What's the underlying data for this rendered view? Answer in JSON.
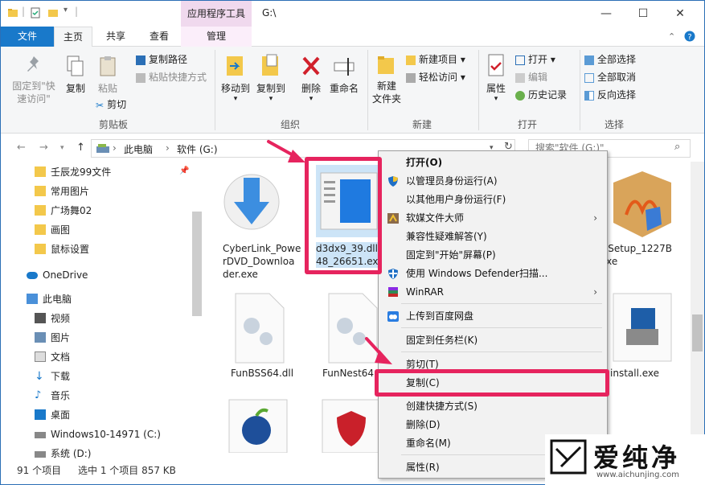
{
  "window": {
    "context_tab_title": "应用程序工具",
    "title": "G:\\",
    "controls": {
      "minimize": "—",
      "maximize": "☐",
      "close": "✕"
    }
  },
  "ribbon_tabs": {
    "file": "文件",
    "home": "主页",
    "share": "共享",
    "view": "查看",
    "manage": "管理"
  },
  "ribbon": {
    "clipboard": {
      "pin": "固定到\"快\n速访问\"",
      "pin_l1": "固定到\"快",
      "pin_l2": "速访问\"",
      "copy": "复制",
      "paste": "粘贴",
      "copy_path": "复制路径",
      "paste_shortcut": "粘贴快捷方式",
      "cut": "剪切",
      "group": "剪贴板"
    },
    "organize": {
      "move_to": "移动到",
      "copy_to": "复制到",
      "delete": "删除",
      "rename": "重命名",
      "group": "组织"
    },
    "new": {
      "new_folder_l1": "新建",
      "new_folder_l2": "文件夹",
      "new_item": "新建项目",
      "easy_access": "轻松访问",
      "group": "新建"
    },
    "open": {
      "properties": "属性",
      "open": "打开",
      "edit": "编辑",
      "history": "历史记录",
      "group": "打开"
    },
    "select": {
      "select_all": "全部选择",
      "select_none": "全部取消",
      "invert": "反向选择",
      "group": "选择"
    }
  },
  "address": {
    "crumbs": [
      "此电脑",
      "软件 (G:)"
    ],
    "separator": "›",
    "search_placeholder": "搜索\"软件 (G:)\""
  },
  "nav": {
    "quick": [
      "壬辰龙99文件",
      "常用图片",
      "广场舞02",
      "画图",
      "鼠标设置"
    ],
    "onedrive": "OneDrive",
    "this_pc": "此电脑",
    "pc_items": [
      "视频",
      "图片",
      "文档",
      "下载",
      "音乐",
      "桌面",
      "Windows10-14971 (C:)",
      "系统 (D:)"
    ]
  },
  "files": [
    {
      "name_l1": "CyberLink_Powe",
      "name_l2": "rDVD_Downloa",
      "name_l3": "der.exe"
    },
    {
      "name_l1": "d3dx9_39.dll-",
      "name_l2": "48_26651.exe",
      "name_l3": ""
    },
    {
      "name_l1": "GSetup_1227B",
      "name_l2": "exe",
      "name_l3": ""
    },
    {
      "name_l1": "FunBSS64.dll",
      "name_l2": "",
      "name_l3": ""
    },
    {
      "name_l1": "FunNest64.",
      "name_l2": "",
      "name_l3": ""
    },
    {
      "name_l1": "install.exe",
      "name_l2": "",
      "name_l3": ""
    }
  ],
  "status": {
    "count": "91 个项目",
    "selected": "选中 1 个项目  857 KB"
  },
  "context_menu": [
    {
      "label": "打开(O)",
      "bold": true
    },
    {
      "label": "以管理员身份运行(A)",
      "icon": "shield-icon"
    },
    {
      "label": "以其他用户身份运行(F)"
    },
    {
      "label": "软媒文件大师",
      "icon": "app-icon",
      "submenu": true
    },
    {
      "label": "兼容性疑难解答(Y)"
    },
    {
      "label": "固定到\"开始\"屏幕(P)"
    },
    {
      "label": "使用 Windows Defender扫描...",
      "icon": "defender-icon"
    },
    {
      "label": "WinRAR",
      "icon": "winrar-icon",
      "submenu": true
    },
    {
      "label": "上传到百度网盘",
      "icon": "cloud-icon"
    },
    {
      "label": "固定到任务栏(K)"
    },
    {
      "label": "剪切(T)"
    },
    {
      "label": "复制(C)"
    },
    {
      "label": "创建快捷方式(S)"
    },
    {
      "label": "删除(D)"
    },
    {
      "label": "重命名(M)"
    },
    {
      "label": "属性(R)"
    }
  ],
  "watermark": {
    "brand": "爱纯净",
    "url": "www.aichunjing.com"
  },
  "colors": {
    "accent": "#1979ca",
    "highlight": "#e6245e",
    "manage_tab": "#f0d9ee"
  }
}
